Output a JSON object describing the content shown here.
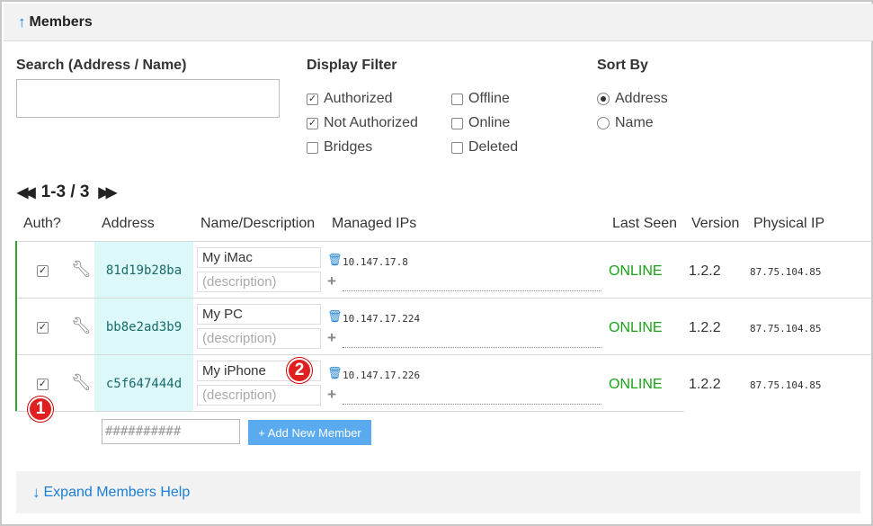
{
  "header": {
    "title": "Members",
    "icon": "arrow-up-icon"
  },
  "search": {
    "label": "Search (Address / Name)",
    "value": ""
  },
  "display_filter": {
    "label": "Display Filter",
    "options": [
      {
        "label": "Authorized",
        "checked": true
      },
      {
        "label": "Not Authorized",
        "checked": true
      },
      {
        "label": "Bridges",
        "checked": false
      },
      {
        "label": "Offline",
        "checked": false
      },
      {
        "label": "Online",
        "checked": false
      },
      {
        "label": "Deleted",
        "checked": false
      }
    ]
  },
  "sort_by": {
    "label": "Sort By",
    "options": [
      {
        "label": "Address",
        "selected": true
      },
      {
        "label": "Name",
        "selected": false
      }
    ]
  },
  "pager": {
    "range": "1-3 / 3"
  },
  "columns": {
    "auth": "Auth?",
    "address": "Address",
    "name": "Name/Description",
    "ips": "Managed IPs",
    "last_seen": "Last Seen",
    "version": "Version",
    "physical_ip": "Physical IP"
  },
  "members": [
    {
      "authorized": true,
      "address": "81d19b28ba",
      "name": "My iMac",
      "description_placeholder": "(description)",
      "ip": "10.147.17.8",
      "last_seen": "ONLINE",
      "version": "1.2.2",
      "physical_ip": "87.75.104.85"
    },
    {
      "authorized": true,
      "address": "bb8e2ad3b9",
      "name": "My PC",
      "description_placeholder": "(description)",
      "ip": "10.147.17.224",
      "last_seen": "ONLINE",
      "version": "1.2.2",
      "physical_ip": "87.75.104.85"
    },
    {
      "authorized": true,
      "address": "c5f647444d",
      "name": "My iPhone",
      "description_placeholder": "(description)",
      "ip": "10.147.17.226",
      "last_seen": "ONLINE",
      "version": "1.2.2",
      "physical_ip": "87.75.104.85"
    }
  ],
  "badges": [
    "1",
    "2"
  ],
  "add_member": {
    "placeholder": "##########",
    "button": "+ Add New Member"
  },
  "help": {
    "label": "Expand Members Help",
    "icon": "arrow-down-icon"
  },
  "colors": {
    "accent": "#1a7fd4",
    "online": "#19a319",
    "address_bg": "#dcf8f8",
    "badge": "#e02020",
    "button": "#5aaaf0"
  }
}
